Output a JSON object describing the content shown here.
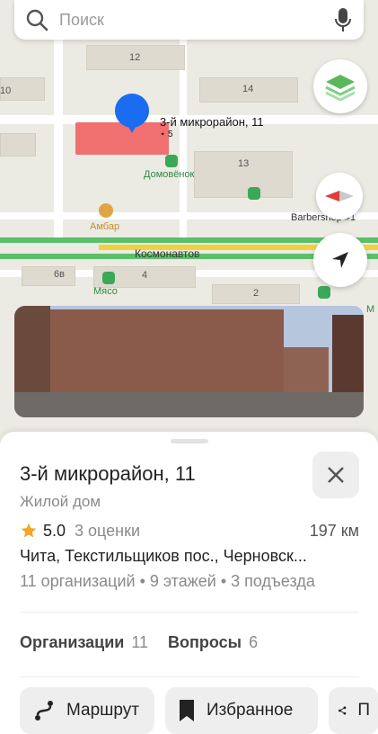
{
  "search": {
    "placeholder": "Поиск"
  },
  "map": {
    "building_numbers": [
      "12",
      "14",
      "10",
      "13",
      "6в",
      "4",
      "2"
    ],
    "selected_label": "3-й микрорайон, 11",
    "selected_label_extra": "⋆ 5",
    "street": "Космонавтов",
    "pois": {
      "domovenok": "Домовёнок",
      "ambar": "Амбар",
      "barbershop": "Barbershop #1",
      "myaso": "Мясо",
      "m": "М"
    },
    "colors": {
      "selected_building": "#f07070",
      "pin": "#1a6df0",
      "poi": "#3aa856"
    }
  },
  "sheet": {
    "title": "3-й микрорайон, 11",
    "subtitle": "Жилой дом",
    "rating": "5.0",
    "ratings_count": "3 оценки",
    "distance": "197 км",
    "address": "Чита, Текстильщиков пос., Черновск...",
    "meta": "11 организаций • 9 этажей • 3 подъезда",
    "tabs": [
      {
        "label": "Организации",
        "count": "11"
      },
      {
        "label": "Вопросы",
        "count": "6"
      }
    ],
    "buttons": {
      "route": "Маршрут",
      "favorite": "Избранное",
      "share": "П"
    }
  }
}
